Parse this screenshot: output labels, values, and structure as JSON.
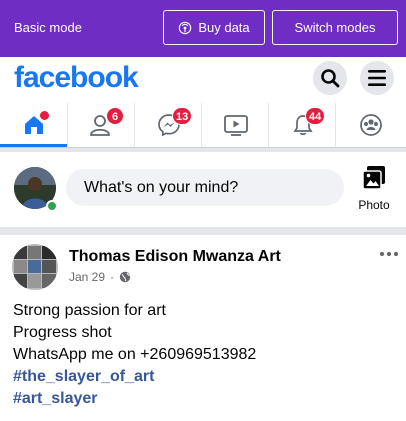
{
  "topbar": {
    "mode_label": "Basic mode",
    "buy_data_label": "Buy data",
    "switch_modes_label": "Switch modes",
    "background": "#6f2dc3"
  },
  "header": {
    "logo": "facebook",
    "brand_color": "#1877f2"
  },
  "nav": {
    "tabs": [
      {
        "name": "home",
        "icon": "home-icon",
        "active": true
      },
      {
        "name": "friends",
        "icon": "friends-icon",
        "badge": "6"
      },
      {
        "name": "messenger",
        "icon": "messenger-icon",
        "badge": "13"
      },
      {
        "name": "watch",
        "icon": "video-icon"
      },
      {
        "name": "notifications",
        "icon": "bell-icon",
        "badge": "44"
      },
      {
        "name": "groups",
        "icon": "groups-icon"
      }
    ]
  },
  "composer": {
    "placeholder": "What's on your mind?",
    "photo_label": "Photo"
  },
  "post": {
    "author": "Thomas Edison Mwanza Art",
    "date": "Jan 29",
    "separator": "·",
    "privacy_icon": "globe-icon",
    "lines": [
      "Strong passion for art",
      "Progress shot",
      "WhatsApp me on +260969513982"
    ],
    "hashtags": [
      "#the_slayer_of_art",
      "#art_slayer"
    ],
    "hashtag_color": "#385898"
  }
}
